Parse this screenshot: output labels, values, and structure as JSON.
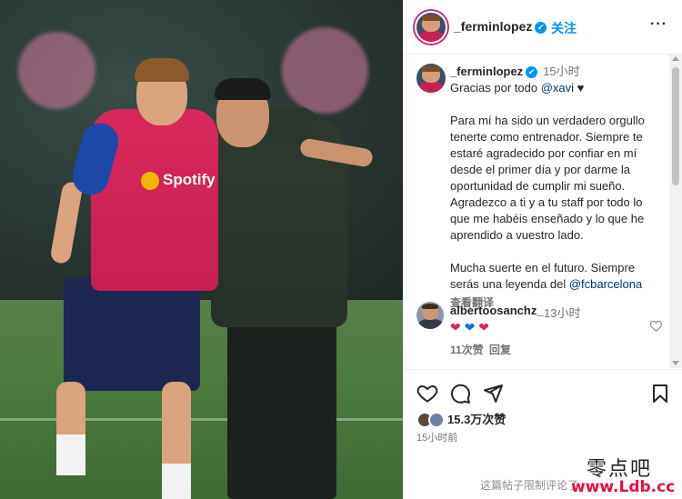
{
  "post": {
    "author": {
      "username": "_ferminlopez",
      "verified_mark": "✔",
      "follow_label": "关注",
      "more_label": "···"
    },
    "caption": {
      "username": "_ferminlopez",
      "time": "15小时",
      "line1_text": "Gracias por todo ",
      "line1_mention": "@xavi",
      "line1_emoji": "♥",
      "paragraph2": "Para mí ha sido un verdadero orgullo tenerte como entrenador. Siempre te estaré agradecido por confiar en mí desde el primer día y por darme la oportunidad de cumplir mi sueño. Agradezco a ti y a tu staff por todo lo que me habéis enseñado y lo que he aprendido a vuestro lado.",
      "paragraph3_text": "Mucha suerte en el futuro. Siempre serás una leyenda del ",
      "paragraph3_mention": "@fcbarcelona",
      "translate_label": "查看翻译"
    },
    "comment": {
      "username": "albertoosanchz_",
      "time": "13小时",
      "hearts": [
        "❤",
        "❤",
        "❤"
      ],
      "likes": "11次赞",
      "reply_label": "回复",
      "like_icon": "heart-outline-icon"
    },
    "actions": {
      "like_icon": "heart-outline-icon",
      "comment_icon": "comment-bubble-icon",
      "share_icon": "paper-plane-icon",
      "save_icon": "bookmark-icon"
    },
    "likes_count": "15.3万次赞",
    "post_time": "15小时前",
    "comments_limited": "这篇帖子限制评论了"
  },
  "photo": {
    "sponsor_text": "Spotify"
  },
  "watermark": {
    "line1": "零点吧",
    "line2": "www.Ldb.cc"
  },
  "colors": {
    "accent_blue": "#0095f6",
    "mention": "#00376b",
    "heart_red": "#e0245e",
    "heart_blue": "#1d6fd8",
    "watermark_red": "#e8103c"
  }
}
